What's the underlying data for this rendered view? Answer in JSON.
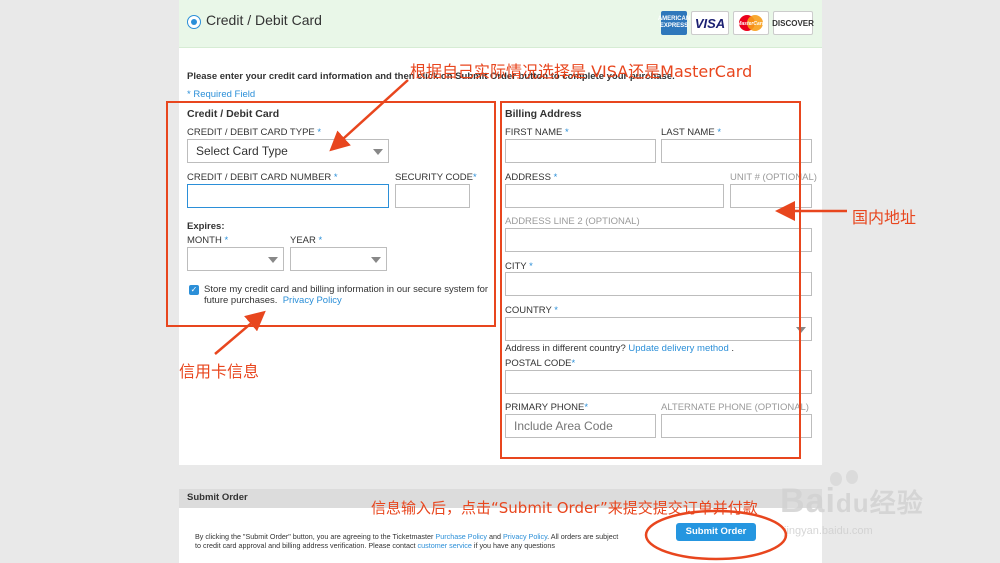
{
  "payment": {
    "title": "Credit / Debit Card",
    "card_logos": [
      {
        "name": "AMERICAN EXPRESS",
        "color": "#2e77bb"
      },
      {
        "name": "VISA",
        "color": "#1a1f71"
      },
      {
        "name": "MasterCard",
        "color": "#eb001b"
      },
      {
        "name": "DISCOVER",
        "color": "#f76f20"
      }
    ]
  },
  "form": {
    "intro": "Please enter your credit card information and then click on Submit Order button to complete your purchase.",
    "required_note": "* Required Field",
    "card_section": {
      "title": "Credit / Debit Card",
      "type_label": "CREDIT / DEBIT CARD TYPE",
      "type_value": "Select Card Type",
      "number_label": "CREDIT / DEBIT CARD NUMBER",
      "security_label": "SECURITY CODE",
      "expires_label": "Expires:",
      "month_label": "MONTH",
      "year_label": "YEAR",
      "store_text": "Store my credit card and billing information in our secure system for future purchases.",
      "privacy_link": "Privacy Policy"
    },
    "billing": {
      "title": "Billing Address",
      "first_name": "FIRST NAME",
      "last_name": "LAST NAME",
      "address": "ADDRESS",
      "unit": "UNIT # (OPTIONAL)",
      "address2": "ADDRESS LINE 2 (OPTIONAL)",
      "city": "CITY",
      "country": "COUNTRY",
      "diff_country": "Address in different country?",
      "delivery_link": "Update delivery method",
      "postal": "POSTAL CODE",
      "primary_phone": "PRIMARY PHONE",
      "phone_placeholder": "Include Area Code",
      "alt_phone": "ALTERNATE PHONE (OPTIONAL)"
    },
    "req_mark": "*"
  },
  "submit": {
    "title": "Submit Order",
    "terms_a": "By clicking the \"Submit Order\" button, you are agreeing to the Ticketmaster ",
    "purchase_policy": "Purchase Policy",
    "and": " and ",
    "privacy_policy": "Privacy Policy",
    "terms_b": ". All orders are subject to credit card approval and billing address verification. Please contact ",
    "customer_service": "customer service",
    "terms_c": " if you have any questions",
    "button": "Submit Order"
  },
  "annotations": {
    "card_type_note": "根据自己实际情况选择是 VISA还是MasterCard",
    "card_info": "信用卡信息",
    "domestic_address": "国内地址",
    "submit_note": "信息输入后，点击“Submit Order”来提交提交订单并付款"
  },
  "watermark": {
    "brand": "Bai",
    "brand2": "du",
    "suffix": "经验",
    "url": "jingyan.baidu.com"
  },
  "colors": {
    "accent": "#2b8fd8",
    "annotation": "#e8461e",
    "header_bg": "#e9f7e8"
  }
}
